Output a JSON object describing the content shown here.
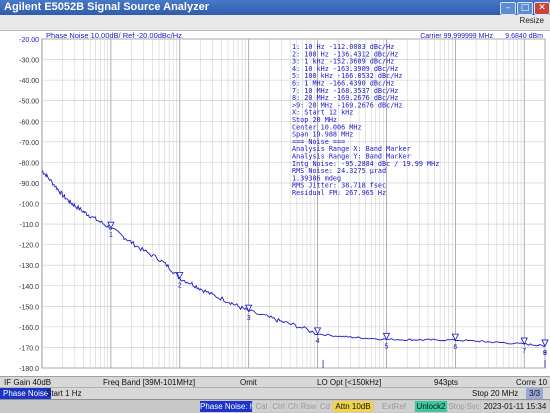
{
  "window": {
    "title": "Agilent E5052B Signal Source Analyzer",
    "resize_label": "Resize"
  },
  "trace": {
    "header": "Phase Noise 10.00dB/ Ref -20.00dBc/Hz",
    "carrier": "Carrier 99.999999 MHz",
    "carrier_power": "9.6840 dBm",
    "y_ticks": [
      "-20.00",
      "-30.00",
      "-40.00",
      "-50.00",
      "-60.00",
      "-70.00",
      "-80.00",
      "-90.00",
      "-100.0",
      "-110.0",
      "-120.0",
      "-130.0",
      "-140.0",
      "-150.0",
      "-160.0",
      "-170.0",
      "-180.0"
    ],
    "marker_lines": [
      "1:  10 Hz    -112.0083 dBc/Hz",
      "2:  100 Hz   -136.4312 dBc/Hz",
      "3:  1 kHz    -152.3609 dBc/Hz",
      "4:  10 kHz   -163.3909 dBc/Hz",
      "5:  100 kHz  -166.0532 dBc/Hz",
      "6:  1 MHz    -166.4390 dBc/Hz",
      "7:  10 MHz   -168.3537 dBc/Hz",
      "8:  20 MHz   -169.2676 dBc/Hz",
      ">9:  20 MHz   -169.2676 dBc/Hz",
      "  X: Start 12 kHz",
      "      Stop 20 MHz",
      "    Center 10.006 MHz",
      "      Span 19.988 MHz",
      "=== Noise ===",
      "Analysis Range X: Band Marker",
      "Analysis Range Y: Band Marker",
      "Intg Noise: -95.2884 dBc / 19.99 MHz",
      "RMS Noise: 24.3275 µrad",
      "             1.39386 mdeg",
      "RMS Jitter: 38.718 fsec",
      "Residual FM: 267.965 Hz"
    ],
    "marker_labels": [
      "1",
      "2",
      "3",
      "4",
      "5",
      "6",
      "7",
      "8",
      "9"
    ],
    "colors": {
      "trace": "#1a1ac8",
      "grid": "#c8c8c8",
      "panel": "#ffffff"
    }
  },
  "chart_data": {
    "type": "line",
    "title": "Phase Noise 10.00dB/ Ref -20.00dBc/Hz",
    "xscale": "log",
    "xlim": [
      1,
      20000000
    ],
    "ylim": [
      -180,
      -20
    ],
    "ylabel": "dBc/Hz",
    "x": [
      1,
      1.2,
      1.6,
      2,
      2.5,
      3,
      4,
      5,
      7,
      10,
      15,
      20,
      30,
      50,
      70,
      100,
      150,
      200,
      300,
      500,
      700,
      1000,
      2000,
      3000,
      5000,
      10000,
      20000,
      30000,
      50000,
      100000,
      200000,
      300000,
      500000,
      1000000,
      2000000,
      3000000,
      5000000,
      10000000,
      15000000,
      20000000
    ],
    "y": [
      -84,
      -87,
      -92,
      -96,
      -99,
      -101,
      -104,
      -106,
      -109,
      -112,
      -116,
      -119,
      -123,
      -127,
      -131,
      -136.4,
      -139,
      -141.5,
      -144.5,
      -147.5,
      -150,
      -152.4,
      -155.5,
      -157.5,
      -159.5,
      -163.4,
      -164.5,
      -165,
      -165.5,
      -166.05,
      -166.2,
      -166.3,
      -166.35,
      -166.44,
      -166.9,
      -167.3,
      -167.7,
      -168.35,
      -168.8,
      -169.27
    ],
    "markers": [
      {
        "label": "1",
        "x": 10,
        "y": -112.0083
      },
      {
        "label": "2",
        "x": 100,
        "y": -136.4312
      },
      {
        "label": "3",
        "x": 1000,
        "y": -152.3609
      },
      {
        "label": "4",
        "x": 10000,
        "y": -163.3909
      },
      {
        "label": "5",
        "x": 100000,
        "y": -166.0532
      },
      {
        "label": "6",
        "x": 1000000,
        "y": -166.439
      },
      {
        "label": "7",
        "x": 10000000,
        "y": -168.3537
      },
      {
        "label": "8",
        "x": 20000000,
        "y": -169.2676
      },
      {
        "label": "9",
        "x": 20000000,
        "y": -169.2676
      }
    ]
  },
  "bottom": {
    "if_gain": "IF Gain 40dB",
    "freq_band": "Freq Band [39M-101MHz]",
    "omit": "Omit",
    "lo_opt": "LO Opt [<150kHz]",
    "points": "943pts",
    "start": "Start 1 Hz",
    "stop": "Stop 20 MHz",
    "page": "3/3",
    "corr": "Corre 10"
  },
  "status": {
    "mode": "Phase Noise",
    "cells": [
      "Phase Noise: Hold",
      "Cal",
      "Ctrl",
      "Ch",
      "Rsw",
      "Cd",
      "Attn 10dB",
      "ExtRef",
      "Unlock2",
      "Stop",
      "Svc",
      "2023-01-11 15:34"
    ]
  }
}
